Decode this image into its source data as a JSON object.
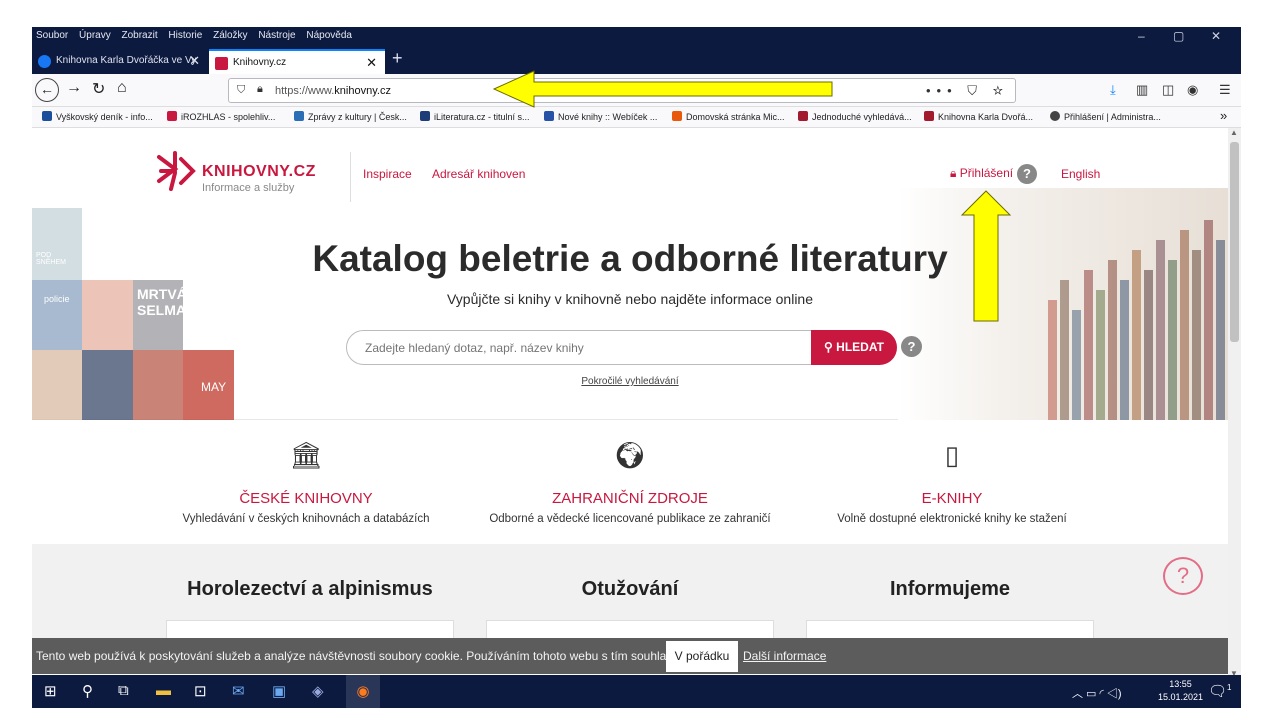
{
  "menubar": {
    "items": [
      "Soubor",
      "Úpravy",
      "Zobrazit",
      "Historie",
      "Záložky",
      "Nástroje",
      "Nápověda"
    ],
    "window_buttons": [
      "–",
      "▢",
      "✕"
    ]
  },
  "tabs": [
    {
      "label": "Knihovna Karla Dvořáčka ve Vy",
      "close": "✕",
      "active": false,
      "icon_color": "#1877f2"
    },
    {
      "label": "Knihovny.cz",
      "close": "✕",
      "active": true,
      "icon_color": "#c8183f"
    }
  ],
  "new_tab": "+",
  "navbar": {
    "back": "←",
    "forward": "→",
    "reload": "↻",
    "home": "⌂",
    "url_prefix": "https://www.",
    "url_domain": "knihovny.cz",
    "page_actions": "••• ⛉ ☆"
  },
  "toolbar_icons": [
    "download-icon",
    "library-icon",
    "sidebar-icon",
    "account-icon",
    "menu-icon"
  ],
  "bookmarks": [
    {
      "label": "Vyškovský deník - info...",
      "color": "#1b4f9c"
    },
    {
      "label": "iROZHLAS - spolehliv...",
      "color": "#c8183f"
    },
    {
      "label": "Zprávy z kultury | Česk...",
      "color": "#2a6fb5"
    },
    {
      "label": "iLiteratura.cz - titulní s...",
      "color": "#1d3c78"
    },
    {
      "label": "Nové knihy :: Webíček ...",
      "color": "#2753a6"
    },
    {
      "label": "Domovská stránka Mic...",
      "color": "#e8590c"
    },
    {
      "label": "Jednoduché vyhledává...",
      "color": "#a11a2e"
    },
    {
      "label": "Knihovna Karla Dvořá...",
      "color": "#a11a2e"
    },
    {
      "label": "Přihlášení | Administra...",
      "color": "#444444"
    }
  ],
  "bookmarks_more": "»",
  "site": {
    "logo_text": "KNIHOVNY.CZ",
    "logo_sub": "Informace a služby",
    "nav": [
      "Inspirace",
      "Adresář knihoven"
    ],
    "login": "Přihlášení",
    "help": "?",
    "english": "English",
    "headline": "Katalog beletrie a odborné literatury",
    "subline": "Vypůjčte si knihy v knihovně nebo najděte informace online",
    "search_placeholder": "Zadejte hledaný dotaz, např. název knihy",
    "search_button": "HLEDAT",
    "advanced": "Pokročilé vyhledávání",
    "accent": "#c8183f"
  },
  "covers": [
    "POD SNĚHEM",
    "policie",
    "MRTVÁ SELMA",
    "MAY"
  ],
  "services": [
    {
      "icon": "bank-icon",
      "title": "ČESKÉ KNIHOVNY",
      "desc": "Vyhledávání v českých knihovnách a databázích"
    },
    {
      "icon": "globe-icon",
      "title": "ZAHRANIČNÍ ZDROJE",
      "desc": "Odborné a vědecké licencované publikace ze zahraničí"
    },
    {
      "icon": "tablet-icon",
      "title": "E-KNIHY",
      "desc": "Volně dostupné elektronické knihy ke stažení"
    }
  ],
  "sections": [
    "Horolezectví a alpinismus",
    "Otužování",
    "Informujeme"
  ],
  "cookie": {
    "text": "Tento web používá k poskytování služeb a analýze návštěvnosti soubory cookie. Používáním tohoto webu s tím souhlasíte.",
    "ok": "V pořádku",
    "more": "Další informace"
  },
  "taskbar": {
    "time": "13:55",
    "date": "15.01.2021",
    "notifications": "1"
  },
  "annotation_color": "#ffff00"
}
